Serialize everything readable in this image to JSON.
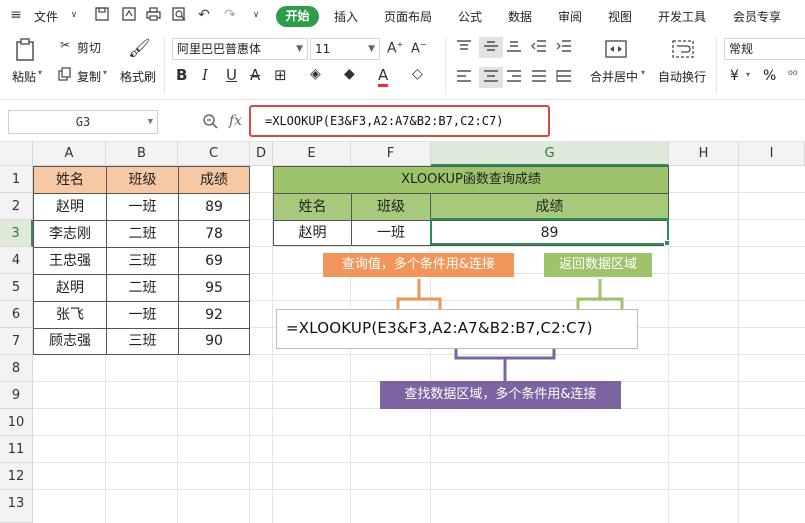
{
  "menubar": {
    "file_label": "文件",
    "tabs": [
      "开始",
      "插入",
      "页面布局",
      "公式",
      "数据",
      "审阅",
      "视图",
      "开发工具",
      "会员专享"
    ]
  },
  "ribbon": {
    "paste": "粘贴",
    "cut": "剪切",
    "copy": "复制",
    "format_painter": "格式刷",
    "font_name": "阿里巴巴普惠体",
    "font_size": "11",
    "merge_center": "合并居中",
    "wrap_text": "自动换行",
    "number_format": "常规",
    "currency_symbol": "¥",
    "percent_symbol": "%"
  },
  "formula_bar": {
    "name_box": "G3",
    "fx": "fx",
    "formula": "=XLOOKUP(E3&F3,A2:A7&B2:B7,C2:C7)"
  },
  "grid": {
    "columns": [
      "A",
      "B",
      "C",
      "D",
      "E",
      "F",
      "G",
      "H",
      "I"
    ],
    "rows": [
      "1",
      "2",
      "3",
      "4",
      "5",
      "6",
      "7",
      "8",
      "9",
      "10",
      "11",
      "12",
      "13"
    ],
    "source_table": {
      "headers": [
        "姓名",
        "班级",
        "成绩"
      ],
      "rows": [
        [
          "赵明",
          "一班",
          "89"
        ],
        [
          "李志刚",
          "二班",
          "78"
        ],
        [
          "王忠强",
          "三班",
          "69"
        ],
        [
          "赵明",
          "二班",
          "95"
        ],
        [
          "张飞",
          "一班",
          "92"
        ],
        [
          "顾志强",
          "三班",
          "90"
        ]
      ]
    },
    "lookup_table": {
      "title": "XLOOKUP函数查询成绩",
      "headers": [
        "姓名",
        "班级",
        "成绩"
      ],
      "row": [
        "赵明",
        "一班",
        "89"
      ]
    }
  },
  "annotations": {
    "lookup_value_note": "查询值，多个条件用&连接",
    "return_range_note": "返回数据区域",
    "formula_display": "=XLOOKUP(E3&F3,A2:A7&B2:B7,C2:C7)",
    "lookup_range_note": "查找数据区域，多个条件用&连接"
  },
  "colors": {
    "accent_green": "#2d9d4a",
    "orange_header": "#f6c9a4",
    "green_header": "#a7c97b",
    "orange_callout": "#f0965a",
    "green_callout": "#9dc36b",
    "purple_callout": "#7c64a3",
    "formula_highlight": "#d84a3f"
  },
  "icons": [
    "save-icon",
    "export-pdf-icon",
    "print-icon",
    "print-preview-icon",
    "undo-icon",
    "redo-icon",
    "paste-icon",
    "scissors-icon",
    "copy-icon",
    "brush-icon",
    "zoom-icon",
    "fx-icon"
  ]
}
